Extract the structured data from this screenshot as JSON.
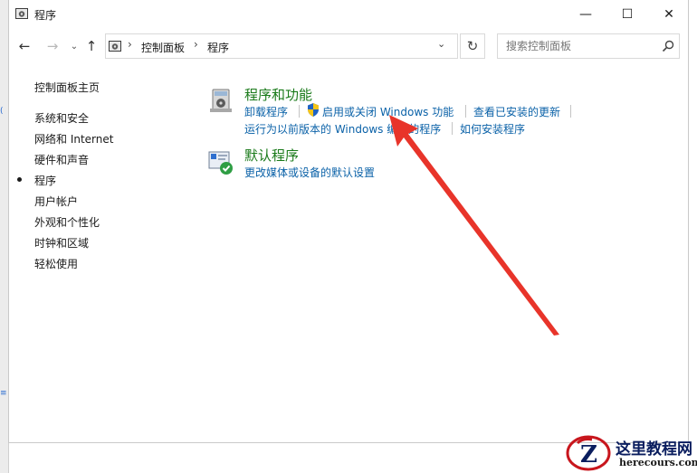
{
  "window": {
    "title": "程序",
    "controls": {
      "minimize": "—",
      "maximize": "☐",
      "close": "✕"
    }
  },
  "nav_buttons": {
    "back": "←",
    "forward": "→",
    "recent": "⌄",
    "up": "↑",
    "refresh": "↻"
  },
  "address": {
    "crumbs": [
      "控制面板",
      "程序"
    ],
    "separator": "›",
    "dropdown": "⌄"
  },
  "search": {
    "placeholder": "搜索控制面板",
    "icon": "search-icon"
  },
  "sidebar": {
    "items": [
      {
        "label": "控制面板主页",
        "current": false
      },
      {
        "label": "系统和安全",
        "current": false
      },
      {
        "label": "网络和 Internet",
        "current": false
      },
      {
        "label": "硬件和声音",
        "current": false
      },
      {
        "label": "程序",
        "current": true
      },
      {
        "label": "用户帐户",
        "current": false
      },
      {
        "label": "外观和个性化",
        "current": false
      },
      {
        "label": "时钟和区域",
        "current": false
      },
      {
        "label": "轻松使用",
        "current": false
      }
    ]
  },
  "main": {
    "programs_features": {
      "title": "程序和功能",
      "icon": "programs-features-icon",
      "links": [
        "卸载程序",
        "启用或关闭 Windows 功能",
        "查看已安装的更新",
        "运行为以前版本的 Windows 编写的程序",
        "如何安装程序"
      ]
    },
    "default_programs": {
      "title": "默认程序",
      "icon": "default-programs-icon",
      "links": [
        "更改媒体或设备的默认设置"
      ]
    }
  },
  "colors": {
    "category_title": "#1a7a1a",
    "link": "#0b62a8",
    "annotation_arrow": "#e8342a"
  },
  "watermark": {
    "title": "这里教程网",
    "url": "herecours.com",
    "logo_letter": "Z"
  }
}
